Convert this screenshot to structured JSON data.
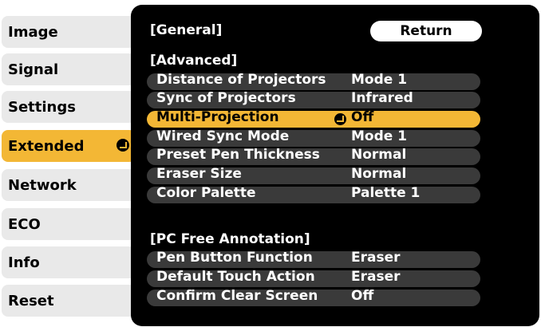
{
  "menu": {
    "items": [
      {
        "label": "Image"
      },
      {
        "label": "Signal"
      },
      {
        "label": "Settings"
      },
      {
        "label": "Extended"
      },
      {
        "label": "Network"
      },
      {
        "label": "ECO"
      },
      {
        "label": "Info"
      },
      {
        "label": "Reset"
      }
    ],
    "active_index": 3
  },
  "panel": {
    "section_general": "[General]",
    "return_label": "Return",
    "section_advanced": "[Advanced]",
    "advanced_rows": [
      {
        "label": "Distance of Projectors",
        "value": "Mode 1"
      },
      {
        "label": "Sync of Projectors",
        "value": "Infrared"
      },
      {
        "label": "Multi-Projection",
        "value": "Off"
      },
      {
        "label": "Wired Sync Mode",
        "value": "Mode 1"
      },
      {
        "label": "Preset Pen Thickness",
        "value": "Normal"
      },
      {
        "label": "Eraser Size",
        "value": "Normal"
      },
      {
        "label": "Color Palette",
        "value": "Palette 1"
      }
    ],
    "selected_row_index": 2,
    "section_pc_free": "[PC Free Annotation]",
    "pc_free_rows": [
      {
        "label": "Pen Button Function",
        "value": "Eraser"
      },
      {
        "label": "Default Touch Action",
        "value": "Eraser"
      },
      {
        "label": "Confirm Clear Screen",
        "value": "Off"
      }
    ]
  },
  "colors": {
    "highlight": "#f3b735",
    "menu_bg": "#e9e9e9",
    "panel_bg": "#000000",
    "row_bg": "#3a3a3a"
  }
}
